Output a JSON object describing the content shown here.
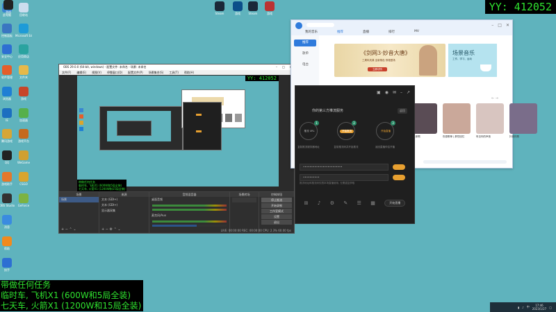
{
  "counter": "YY: 412052",
  "desktop_icons": [
    {
      "label": "此电脑",
      "color": "#3a86d1"
    },
    {
      "label": "回收站",
      "color": "#cde"
    },
    {
      "label": "控制面板",
      "color": "#3a76c1"
    },
    {
      "label": "Microsoft Edge",
      "color": "#1e9bd7"
    },
    {
      "label": "安全中心",
      "color": "#2d6fd2"
    },
    {
      "label": "应用商店",
      "color": "#2aa3a0"
    },
    {
      "label": "软件管理",
      "color": "#e45f2b"
    },
    {
      "label": "文件夹",
      "color": "#e6b94a"
    },
    {
      "label": "浏览器",
      "color": "#1f7fd4"
    },
    {
      "label": "游戏",
      "color": "#c7462a"
    },
    {
      "label": "IE",
      "color": "#1c6fc0"
    },
    {
      "label": "加速器",
      "color": "#56b04c"
    },
    {
      "label": "腾讯游戏",
      "color": "#d6a636"
    },
    {
      "label": "游戏平台",
      "color": "#c56a1e"
    },
    {
      "label": "QQ",
      "color": "#222"
    },
    {
      "label": "WeGame",
      "color": "#d0a030"
    },
    {
      "label": "游戏助手",
      "color": "#e4782b"
    },
    {
      "label": "CSGO",
      "color": "#d9a52e"
    },
    {
      "label": "OBS Studio",
      "color": "#333"
    },
    {
      "label": "GeForce",
      "color": "#7cb342"
    },
    {
      "label": "消息",
      "color": "#3a8be0"
    },
    {
      "label": "帮助",
      "color": "#f08a1e"
    },
    {
      "label": "快手",
      "color": "#2d6fd2"
    },
    {
      "label": "Steam",
      "color": "#1b2838"
    },
    {
      "label": "游戏",
      "color": "#0b4f8a"
    },
    {
      "label": "Steam",
      "color": "#1b2838"
    },
    {
      "label": "游戏",
      "color": "#b33"
    },
    {
      "label": "游戏",
      "color": "#222"
    }
  ],
  "obs": {
    "title": "OBS 29.0.0 (64-bit, windows) - 配置文件: 未命名 - 场景: 未命名",
    "menu": [
      "文件(F)",
      "编辑(E)",
      "视图(V)",
      "停靠窗口(D)",
      "配置文件(P)",
      "场景集合(S)",
      "工具(T)",
      "帮助(H)"
    ],
    "overlay_lines": [
      "带做任何任务",
      "临时车, 飞机X1 (600W和5局全装)",
      "七天车, 火箭X1 (1200W和15局全装)"
    ],
    "docks": {
      "scenes": "场景",
      "scene_item": "场景",
      "sources": "来源",
      "source_items": [
        "文本 (GDI+)",
        "文本 (GDI+)",
        "显示器采集"
      ],
      "mixer": "音频混音器",
      "mixer_tracks": [
        "桌面音频",
        "麦克风/Aux"
      ],
      "transitions": "场景转场",
      "controls": "控制按钮",
      "control_buttons": [
        "停止推流",
        "开始录制",
        "工作室模式",
        "设置",
        "退出"
      ]
    },
    "status": "LIVE: 00:00:00  REC: 00:00:00  CPU: 2.3%  60.00 fps"
  },
  "dark_app": {
    "title": "你的第三方推流服务",
    "mini_btn": "返回",
    "steps": [
      {
        "num": "1",
        "pill": "推流 URL",
        "caption": "复制推流服务器地址"
      },
      {
        "num": "2",
        "pill": "开始推流",
        "caption": "复制推流码并开始推流"
      },
      {
        "num": "3",
        "pill": "开始直播",
        "caption": "返回直播伴侣开播"
      }
    ],
    "field1": "••••••••••••••••••••••••",
    "field2": "••••••••••",
    "hint": "推流地址和推流码仅限本场直播使用, 无需重复获取",
    "bottom_icons": [
      "⊞",
      "♪",
      "⚙",
      "✎",
      "☰",
      "▦"
    ],
    "start": "开始直播"
  },
  "music": {
    "tabs": [
      "我的音乐",
      "推荐",
      "直播",
      "排行",
      "MV"
    ],
    "sidebar": [
      "推荐",
      "歌单",
      "电台"
    ],
    "banner_title": "《剑网3·妙音大唐》",
    "banner_sub": "三周年庆典 全新角色 惊艳登场",
    "banner_btn": "立即试听",
    "side_banner_title": "场景音乐",
    "side_banner_sub": "工作、学习、运动",
    "cards": [
      {
        "cap": "2021新歌"
      },
      {
        "cap": "伤感歌单 | 那些回忆"
      },
      {
        "cap": "听见你的声音"
      },
      {
        "cap": "抖音热歌"
      }
    ]
  },
  "tray": {
    "time": "17:46",
    "date": "2023/1/27"
  }
}
